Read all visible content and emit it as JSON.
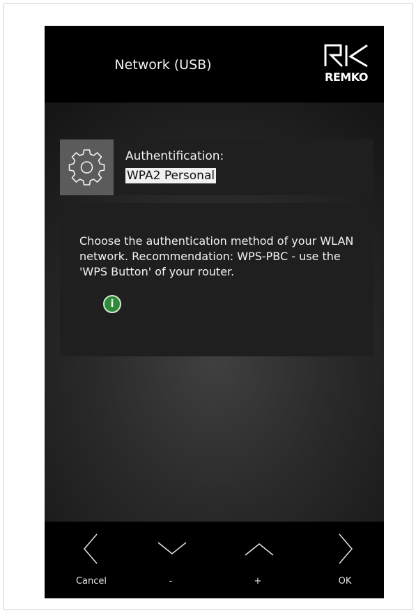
{
  "header": {
    "title": "Network (USB)",
    "logo_text": "REMKO"
  },
  "setting": {
    "icon": "gear-icon",
    "label": "Authentification:",
    "value": "WPA2 Personal"
  },
  "info": {
    "text": "Choose the authentication method of your WLAN network. Recommendation: WPS-PBC - use the 'WPS Button' of your router.",
    "icon": "info-icon",
    "icon_glyph": "i",
    "icon_color": "#2f8a3a"
  },
  "footer": {
    "buttons": [
      {
        "icon": "chevron-left-icon",
        "label": "Cancel"
      },
      {
        "icon": "chevron-down-icon",
        "label": "-"
      },
      {
        "icon": "chevron-up-icon",
        "label": "+"
      },
      {
        "icon": "chevron-right-icon",
        "label": "OK"
      }
    ]
  }
}
